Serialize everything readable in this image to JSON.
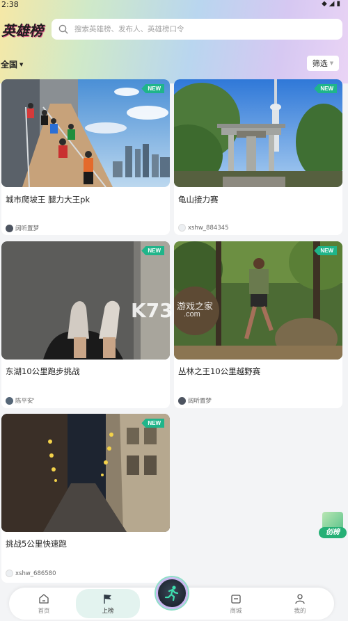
{
  "status": {
    "time": "2:38",
    "icons": "◆◢▮"
  },
  "app": {
    "logo": "英雄榜"
  },
  "search": {
    "placeholder": "搜索英雄榜、发布人、英雄榜口令"
  },
  "filters": {
    "region": "全国",
    "filter_label": "筛选"
  },
  "cards": [
    {
      "title": "城市爬坡王 腿力大王pk",
      "author": "阔听置梦",
      "badge": "NEW"
    },
    {
      "title": "龟山接力赛",
      "author": "xshw_884345",
      "badge": "NEW"
    },
    {
      "title": "东湖10公里跑步挑战",
      "author": "陈平安'",
      "badge": "NEW"
    },
    {
      "title": "丛林之王10公里越野赛",
      "author": "阔听置梦",
      "badge": "NEW"
    },
    {
      "title": "挑战5公里快速跑",
      "author": "xshw_686580",
      "badge": "NEW"
    }
  ],
  "floating": {
    "create_label": "创榜"
  },
  "watermark": {
    "brand": "K73",
    "cn": "游戏之家",
    "domain": ".com"
  },
  "tabbar": {
    "home": "首页",
    "leaderboard": "上榜",
    "shop": "商城",
    "mine": "我的"
  },
  "colors": {
    "accent": "#1fb58a",
    "active_tab_bg": "#e3f3ef"
  },
  "icons": {
    "search": "search-icon",
    "home": "home-icon",
    "flag": "flag-icon",
    "runner": "runner-icon",
    "shop": "shopping-bag-icon",
    "user": "user-icon"
  }
}
